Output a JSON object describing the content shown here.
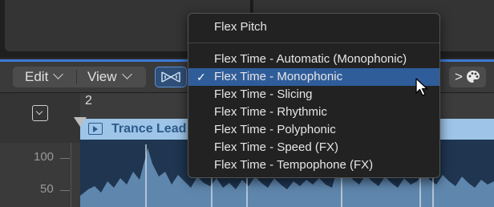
{
  "toolbar": {
    "edit_label": "Edit",
    "view_label": "View",
    "flex_button_icon": "flex-mode-icon",
    "right_button_icon": "palette-icon",
    "right_button_glyph": ">"
  },
  "ruler": {
    "bar_number": "2"
  },
  "track": {
    "region_name": "Trance Lead",
    "scale_labels": [
      "100",
      "50"
    ],
    "region_color": "#9ec5e8"
  },
  "menu": {
    "items": [
      {
        "label": "Flex Pitch",
        "checked": false
      },
      {
        "label": "Flex Time - Automatic (Monophonic)",
        "checked": false
      },
      {
        "label": "Flex Time - Monophonic",
        "checked": true
      },
      {
        "label": "Flex Time - Slicing",
        "checked": false
      },
      {
        "label": "Flex Time - Rhythmic",
        "checked": false
      },
      {
        "label": "Flex Time - Polyphonic",
        "checked": false
      },
      {
        "label": "Flex Time - Speed (FX)",
        "checked": false
      },
      {
        "label": "Flex Time - Tempophone (FX)",
        "checked": false
      }
    ],
    "check_glyph": "✓",
    "highlight_color": "#2f5d9a"
  }
}
